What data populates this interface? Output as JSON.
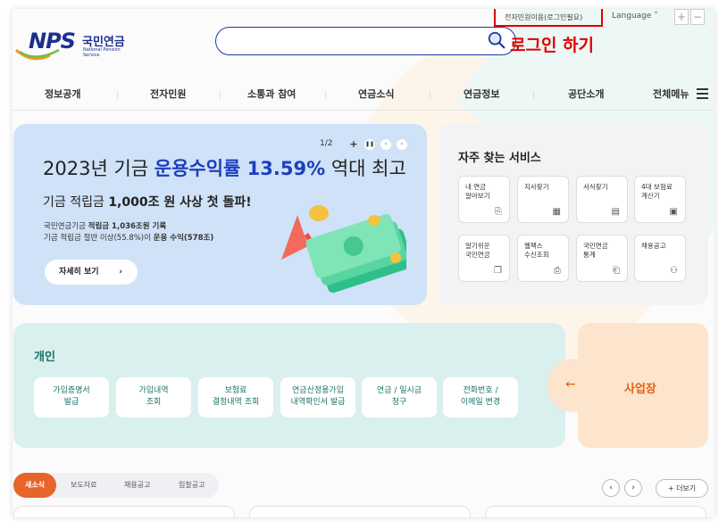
{
  "header": {
    "logo_text": "NPS",
    "logo_korean": "국민연금",
    "logo_english": "National Pension Service",
    "search_placeholder": "",
    "util_civil": "전자민원이용(로그인필요)",
    "util_language": "Language ˅",
    "zoom_in": "+",
    "zoom_out": "−",
    "login_annotation": "로그인 하기"
  },
  "nav": {
    "items": [
      "정보공개",
      "전자민원",
      "소통과 참여",
      "연금소식",
      "연금정보",
      "공단소개"
    ],
    "all_menu": "전체메뉴"
  },
  "banner": {
    "pager": "1/2",
    "headline_pre": "2023년 기금 ",
    "headline_highlight": "운용수익률 13.59%",
    "headline_post": " 역대 최고",
    "sub_pre": "기금 적립금 ",
    "sub_bold": "1,000조 원 사상 첫 돌파!",
    "line1_pre": "국민연금기금 ",
    "line1_bold": "적립금 1,036조원 기록",
    "line2_pre": "기금 적립금 절반 이상(55.8%)이 ",
    "line2_bold": "운용 수익(578조)",
    "more_label": "자세히 보기",
    "more_arrow": "›",
    "colors": {
      "bg": "#cfe2f7",
      "accent": "#1d3fbd"
    }
  },
  "services": {
    "title": "자주 찾는 서비스",
    "cards": [
      {
        "label": "내 연금\n알아보기",
        "icon": "magnify-doc-icon",
        "glyph": "⎘"
      },
      {
        "label": "지사찾기",
        "icon": "building-icon",
        "glyph": "▦"
      },
      {
        "label": "서식찾기",
        "icon": "document-icon",
        "glyph": "▤"
      },
      {
        "label": "4대 보험료\n계산기",
        "icon": "calculator-icon",
        "glyph": "▣"
      },
      {
        "label": "알기쉬운\n국민연금",
        "icon": "guide-doc-icon",
        "glyph": "❐"
      },
      {
        "label": "웹팩스\n수신조회",
        "icon": "printer-icon",
        "glyph": "⎙"
      },
      {
        "label": "국민연금\n통계",
        "icon": "stats-doc-icon",
        "glyph": "⎗"
      },
      {
        "label": "채용공고",
        "icon": "person-check-icon",
        "glyph": "⚇"
      }
    ]
  },
  "personal": {
    "title": "개인",
    "buttons": [
      "가입증명서\n발급",
      "가입내역\n조회",
      "보험료\n결정내역 조회",
      "연금산정용가입\n내역확인서 발급",
      "연금 / 일시금\n청구",
      "전화번호 /\n이메일 변경"
    ],
    "color": "#1a7367"
  },
  "business": {
    "label": "사업장",
    "arrow": "←",
    "color": "#e0641b"
  },
  "news": {
    "tabs": [
      "새소식",
      "보도자료",
      "채용공고",
      "입찰공고"
    ],
    "active_tab": 0,
    "prev": "‹",
    "next": "›",
    "more_label": "+ 더보기"
  }
}
